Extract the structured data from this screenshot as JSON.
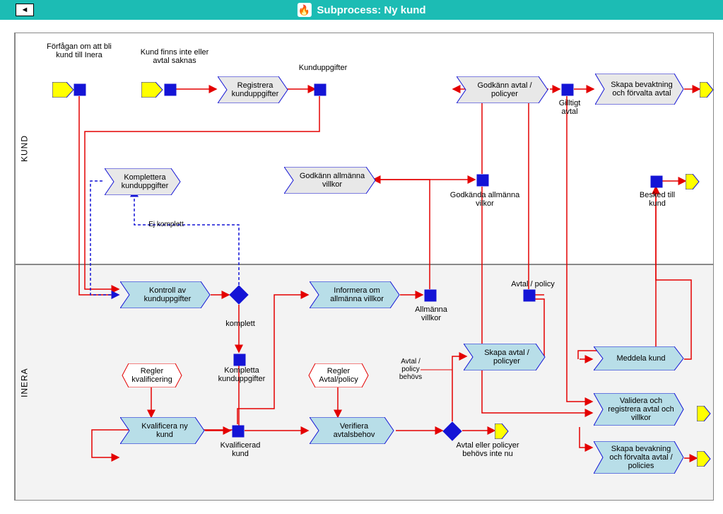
{
  "header": {
    "title": "Subprocess: Ny kund",
    "back": "◄"
  },
  "lanes": {
    "kund": "KUND",
    "inera": "INERA"
  },
  "events": {
    "e1": "Förfågan om att bli kund till Inera",
    "e2": "Kund finns inte eller avtal saknas",
    "e3": "Kunduppgifter",
    "e4": "Gilltigt avtal",
    "e5": "Godkända allmänna vilkor",
    "e6": "Besked till kund",
    "e7": "komplett",
    "e8": "Kompletta kunduppgifter",
    "e9": "Allmänna villkor",
    "e10": "Avtal / policy",
    "e11": "Kvalificerad kund",
    "e12": "Avtal / policy behövs",
    "e13": "Avtal eller policyer behövs inte nu",
    "e14": "Ej komplett"
  },
  "activities": {
    "a1": "Registrera kunduppgifter",
    "a2": "Komplettera kunduppgifter",
    "a3": "Godkänn allmänna villkor",
    "a4": "Godkänn avtal / policyer",
    "a5": "Skapa bevaktning och förvalta avtal",
    "a6": "Kontroll av kunduppgifter",
    "a7": "Informera om allmänna villkor",
    "a8": "Skapa avtal / policyer",
    "a9": "Kvalificera ny kund",
    "a10": "Verifiera avtalsbehov",
    "a11": "Meddela kund",
    "a12": "Validera och registrera avtal och villkor",
    "a13": "Skapa bevakning och förvalta avtal / policies"
  },
  "rules": {
    "r1": "Regler kvalificering",
    "r2": "Regler Avtal/policy"
  }
}
